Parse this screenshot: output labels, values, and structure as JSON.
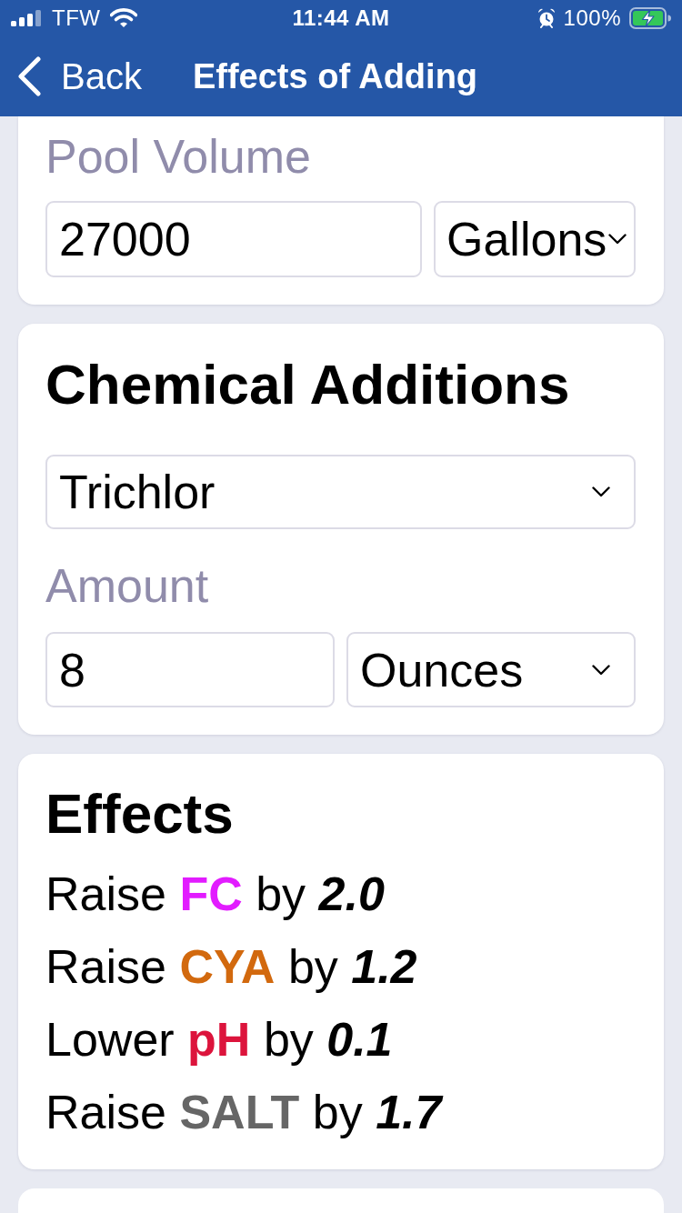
{
  "status_bar": {
    "carrier": "TFW",
    "time": "11:44 AM",
    "battery": "100%"
  },
  "nav_bar": {
    "back": "Back",
    "title": "Effects of Adding"
  },
  "pool_volume": {
    "label": "Pool Volume",
    "value": "27000",
    "unit": "Gallons"
  },
  "chemical_additions": {
    "title": "Chemical Additions",
    "chemical": "Trichlor",
    "amount_label": "Amount",
    "amount": "8",
    "amount_unit": "Ounces"
  },
  "effects": {
    "title": "Effects",
    "items": [
      {
        "action": "Raise",
        "parameter": "FC",
        "color": "#e21cff",
        "preposition": "by",
        "amount": "2.0"
      },
      {
        "action": "Raise",
        "parameter": "CYA",
        "color": "#d2690e",
        "preposition": "by",
        "amount": "1.2"
      },
      {
        "action": "Lower",
        "parameter": "pH",
        "color": "#dc143c",
        "preposition": "by",
        "amount": "0.1"
      },
      {
        "action": "Raise",
        "parameter": "SALT",
        "color": "#666666",
        "preposition": "by",
        "amount": "1.7"
      }
    ]
  }
}
